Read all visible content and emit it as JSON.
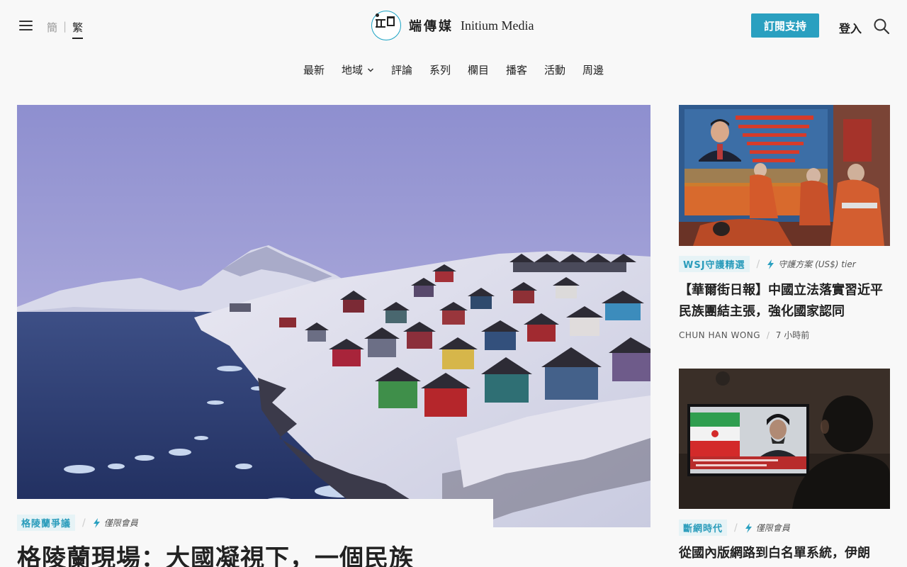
{
  "header": {
    "lang_simplified": "簡",
    "lang_separator": "|",
    "lang_traditional": "繁",
    "logo_cn": "端傳媒",
    "logo_en": "Initium Media",
    "subscribe_label": "訂閱支持",
    "login_label": "登入",
    "accent_color": "#2aa0c0"
  },
  "nav": {
    "items": [
      {
        "label": "最新"
      },
      {
        "label": "地域",
        "has_dropdown": true
      },
      {
        "label": "評論"
      },
      {
        "label": "系列"
      },
      {
        "label": "欄目"
      },
      {
        "label": "播客"
      },
      {
        "label": "活動"
      },
      {
        "label": "周邊"
      }
    ]
  },
  "hero": {
    "tag": "格陵蘭爭議",
    "separator": "/",
    "access": "僅限會員",
    "title": "格陵蘭現場：大國凝視下，一個民族"
  },
  "side_articles": [
    {
      "tag": "WSJ守護精選",
      "separator": "/",
      "access": "守護方案 (US$) tier",
      "title": "【華爾街日報】中國立法落實習近平民族團結主張，強化國家認同",
      "author": "CHUN HAN WONG",
      "byline_separator": "/",
      "time": "7 小時前"
    },
    {
      "tag": "斷網時代",
      "separator": "/",
      "access": "僅限會員",
      "title": "從國內版網路到白名單系統，伊朗"
    }
  ]
}
